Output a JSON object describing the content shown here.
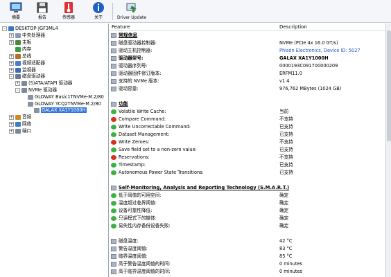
{
  "toolbar": [
    {
      "label": "摘要",
      "icon": "monitor-icon"
    },
    {
      "label": "报告",
      "icon": "floppy-disk-icon"
    },
    {
      "label": "传感器",
      "icon": "thermometer-icon"
    },
    {
      "label": "关于",
      "icon": "info-icon"
    },
    {
      "label": "Driver Update",
      "icon": "driver-update-icon"
    }
  ],
  "tree": [
    {
      "label": "DESKTOP-JGF3ML4",
      "expander": "-"
    },
    {
      "label": "中央处理器",
      "expander": "+"
    },
    {
      "label": "主板",
      "expander": "+"
    },
    {
      "label": "内存",
      "expander": ""
    },
    {
      "label": "总线",
      "expander": "+"
    },
    {
      "label": "视频适配器",
      "expander": "+"
    },
    {
      "label": "监视器",
      "expander": "+"
    },
    {
      "label": "磁盘驱动器",
      "expander": "-"
    },
    {
      "label": "(S)ATA/ATAPI 驱动器",
      "expander": "+"
    },
    {
      "label": "NVMe 驱动器",
      "expander": "-"
    },
    {
      "label": "GLOWAY Basic1TNVMe-M.2/80",
      "expander": ""
    },
    {
      "label": "GLOWAY YCQ2TNVMe-M.2/80",
      "expander": ""
    },
    {
      "label": "GALAX XA1Y1000H",
      "expander": ""
    },
    {
      "label": "音频",
      "expander": "+"
    },
    {
      "label": "网络",
      "expander": "+"
    },
    {
      "label": "端口",
      "expander": "+"
    }
  ],
  "header": {
    "feature": "Feature",
    "description": "Description"
  },
  "rows": [
    {
      "type": "section",
      "feature": "常规信息",
      "value": ""
    },
    {
      "type": "item",
      "icon": "grey",
      "feature": "磁盘驱动器控制器:",
      "value": "NVMe (PCIe 4x 16.0 GT/s)"
    },
    {
      "type": "item",
      "icon": "grey",
      "feature": "驱动主机控制器:",
      "value": "Phison Electronics, Device ID: 5027",
      "valueClass": "blue"
    },
    {
      "type": "item",
      "icon": "grey",
      "feature": "驱动器型号:",
      "value": "GALAX XA1Y1000H",
      "featureClass": "bold",
      "valueClass": "bold"
    },
    {
      "type": "item",
      "icon": "grey",
      "feature": "驱动器序列号:",
      "value": "0000193C091700000209"
    },
    {
      "type": "item",
      "icon": "grey",
      "feature": "驱动器固件修订版本:",
      "value": "ERFM11.0"
    },
    {
      "type": "item",
      "icon": "grey",
      "feature": "支持的 NVMe 版本:",
      "value": "v1.4"
    },
    {
      "type": "item",
      "icon": "grey",
      "feature": "驱动容量:",
      "value": "976,762 MBytes (1024 GB)"
    },
    {
      "type": "blank",
      "feature": "",
      "value": ""
    },
    {
      "type": "section",
      "feature": "功能",
      "value": ""
    },
    {
      "type": "item",
      "icon": "ok",
      "feature": "Volatile Write Cache:",
      "value": "当前"
    },
    {
      "type": "item",
      "icon": "no",
      "feature": "Compare Command:",
      "value": "不支持"
    },
    {
      "type": "item",
      "icon": "ok",
      "feature": "Write Uncorrectable Command:",
      "value": "已支持"
    },
    {
      "type": "item",
      "icon": "ok",
      "feature": "Dataset Management:",
      "value": "已支持"
    },
    {
      "type": "item",
      "icon": "no",
      "feature": "Write Zeroes:",
      "value": "不支持"
    },
    {
      "type": "item",
      "icon": "ok",
      "feature": "Save field set to a non-zero value:",
      "value": "已支持"
    },
    {
      "type": "item",
      "icon": "no",
      "feature": "Reservations:",
      "value": "不支持"
    },
    {
      "type": "item",
      "icon": "ok",
      "feature": "Timestamp:",
      "value": "已支持"
    },
    {
      "type": "item",
      "icon": "ok",
      "feature": "Autonomous Power State Transitions:",
      "value": "已支持"
    },
    {
      "type": "blank",
      "feature": "",
      "value": ""
    },
    {
      "type": "section",
      "feature": "Self-Monitoring, Analysis and Reporting Technology (S.M.A.R.T.)",
      "value": ""
    },
    {
      "type": "item",
      "icon": "ok",
      "feature": "低于阈值的可用空间:",
      "value": "确定"
    },
    {
      "type": "item",
      "icon": "ok",
      "feature": "温度超过临界阈值:",
      "value": "确定"
    },
    {
      "type": "item",
      "icon": "ok",
      "feature": "设备可靠性降低:",
      "value": "确定"
    },
    {
      "type": "item",
      "icon": "ok",
      "feature": "只读模式下的媒体:",
      "value": "确定"
    },
    {
      "type": "item",
      "icon": "ok",
      "feature": "易失性内存备份设备失败:",
      "value": "确定"
    },
    {
      "type": "blank",
      "feature": "",
      "value": ""
    },
    {
      "type": "item",
      "icon": "grey",
      "feature": "磁盘温度:",
      "value": "42 °C"
    },
    {
      "type": "item",
      "icon": "grey",
      "feature": "警告温度阈值:",
      "value": "83 °C"
    },
    {
      "type": "item",
      "icon": "grey",
      "feature": "临界温度阈值:",
      "value": "85 °C"
    },
    {
      "type": "item",
      "icon": "grey",
      "feature": "高于警告温度阈值的时间:",
      "value": "0 minutes"
    },
    {
      "type": "item",
      "icon": "grey",
      "feature": "高于临界温度阈值的时间:",
      "value": "0 minutes"
    }
  ]
}
